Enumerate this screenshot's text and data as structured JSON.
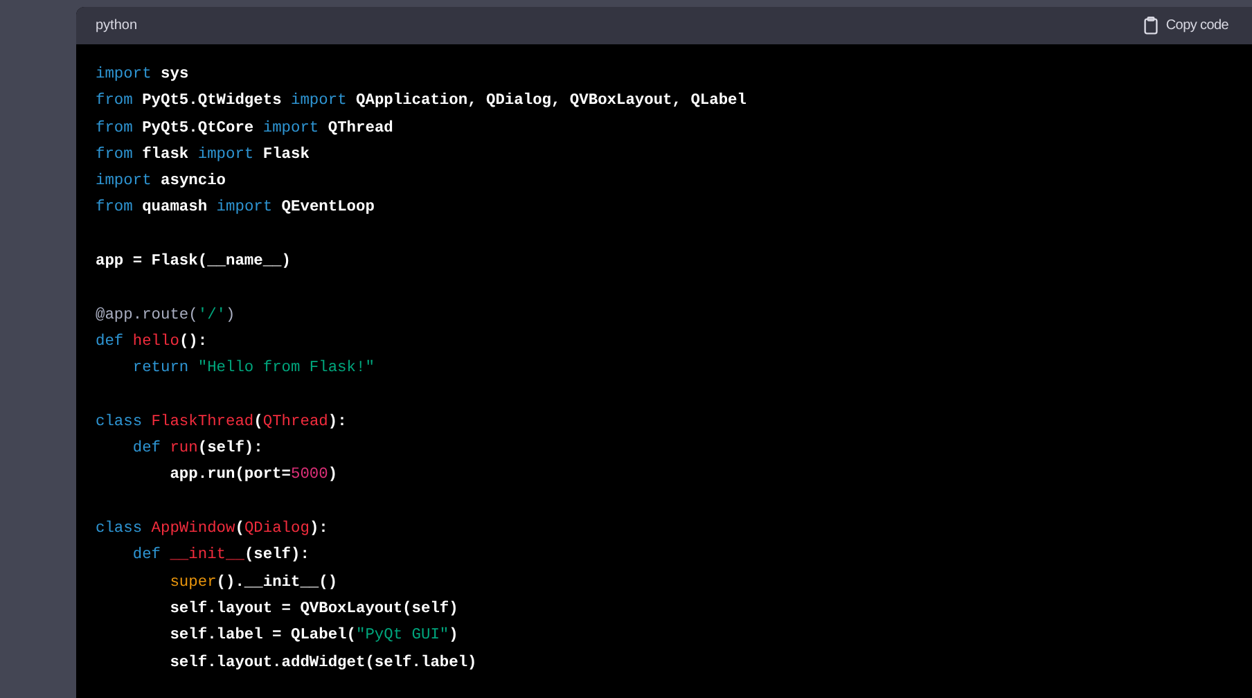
{
  "code_block": {
    "language": "python",
    "copy_button": {
      "label": "Copy code"
    },
    "lines": [
      {
        "kind": "code",
        "tokens": [
          {
            "text": "import",
            "kind": "keyword"
          },
          {
            "text": " sys",
            "kind": "plain"
          }
        ]
      },
      {
        "kind": "code",
        "tokens": [
          {
            "text": "from",
            "kind": "keyword"
          },
          {
            "text": " PyQt5.QtWidgets ",
            "kind": "plain"
          },
          {
            "text": "import",
            "kind": "keyword"
          },
          {
            "text": " QApplication, QDialog, QVBoxLayout, QLabel",
            "kind": "plain"
          }
        ]
      },
      {
        "kind": "code",
        "tokens": [
          {
            "text": "from",
            "kind": "keyword"
          },
          {
            "text": " PyQt5.QtCore ",
            "kind": "plain"
          },
          {
            "text": "import",
            "kind": "keyword"
          },
          {
            "text": " QThread",
            "kind": "plain"
          }
        ]
      },
      {
        "kind": "code",
        "tokens": [
          {
            "text": "from",
            "kind": "keyword"
          },
          {
            "text": " flask ",
            "kind": "plain"
          },
          {
            "text": "import",
            "kind": "keyword"
          },
          {
            "text": " Flask",
            "kind": "plain"
          }
        ]
      },
      {
        "kind": "code",
        "tokens": [
          {
            "text": "import",
            "kind": "keyword"
          },
          {
            "text": " asyncio",
            "kind": "plain"
          }
        ]
      },
      {
        "kind": "code",
        "tokens": [
          {
            "text": "from",
            "kind": "keyword"
          },
          {
            "text": " quamash ",
            "kind": "plain"
          },
          {
            "text": "import",
            "kind": "keyword"
          },
          {
            "text": " QEventLoop",
            "kind": "plain"
          }
        ]
      },
      {
        "kind": "blank"
      },
      {
        "kind": "code",
        "tokens": [
          {
            "text": "app = Flask(__name__)",
            "kind": "plain"
          }
        ]
      },
      {
        "kind": "blank"
      },
      {
        "kind": "code",
        "tokens": [
          {
            "text": "@app.route(",
            "kind": "decorator"
          },
          {
            "text": "'/'",
            "kind": "string"
          },
          {
            "text": ")",
            "kind": "decorator"
          }
        ]
      },
      {
        "kind": "code",
        "tokens": [
          {
            "text": "def",
            "kind": "keyword"
          },
          {
            "text": " hello",
            "kind": "name"
          },
          {
            "text": "():",
            "kind": "plain"
          }
        ]
      },
      {
        "kind": "code",
        "tokens": [
          {
            "text": "    return",
            "kind": "keyword"
          },
          {
            "text": " \"Hello from Flask!\"",
            "kind": "string"
          }
        ]
      },
      {
        "kind": "blank"
      },
      {
        "kind": "code",
        "tokens": [
          {
            "text": "class",
            "kind": "keyword"
          },
          {
            "text": " FlaskThread",
            "kind": "name"
          },
          {
            "text": "(",
            "kind": "plain"
          },
          {
            "text": "QThread",
            "kind": "name"
          },
          {
            "text": "):",
            "kind": "plain"
          }
        ]
      },
      {
        "kind": "code",
        "tokens": [
          {
            "text": "    def",
            "kind": "keyword"
          },
          {
            "text": " run",
            "kind": "name"
          },
          {
            "text": "(self):",
            "kind": "plain"
          }
        ]
      },
      {
        "kind": "code",
        "tokens": [
          {
            "text": "        app.run(port=",
            "kind": "plain"
          },
          {
            "text": "5000",
            "kind": "number"
          },
          {
            "text": ")",
            "kind": "plain"
          }
        ]
      },
      {
        "kind": "blank"
      },
      {
        "kind": "code",
        "tokens": [
          {
            "text": "class",
            "kind": "keyword"
          },
          {
            "text": " AppWindow",
            "kind": "name"
          },
          {
            "text": "(",
            "kind": "plain"
          },
          {
            "text": "QDialog",
            "kind": "name"
          },
          {
            "text": "):",
            "kind": "plain"
          }
        ]
      },
      {
        "kind": "code",
        "tokens": [
          {
            "text": "    def",
            "kind": "keyword"
          },
          {
            "text": " __init__",
            "kind": "name"
          },
          {
            "text": "(self):",
            "kind": "plain"
          }
        ]
      },
      {
        "kind": "code",
        "tokens": [
          {
            "text": "        super",
            "kind": "builtin"
          },
          {
            "text": "().__init__()",
            "kind": "plain"
          }
        ]
      },
      {
        "kind": "code",
        "tokens": [
          {
            "text": "        self.layout = QVBoxLayout(self)",
            "kind": "plain"
          }
        ]
      },
      {
        "kind": "code",
        "tokens": [
          {
            "text": "        self.label = QLabel(",
            "kind": "plain"
          },
          {
            "text": "\"PyQt GUI\"",
            "kind": "string"
          },
          {
            "text": ")",
            "kind": "plain"
          }
        ]
      },
      {
        "kind": "code",
        "tokens": [
          {
            "text": "        self.layout.addWidget(self.label)",
            "kind": "plain"
          }
        ]
      }
    ]
  }
}
